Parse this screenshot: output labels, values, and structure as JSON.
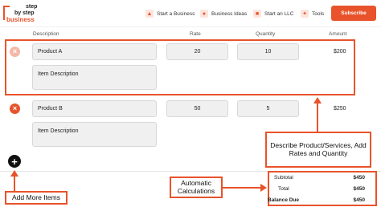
{
  "nav": {
    "logo": {
      "line1": "step",
      "line2": "by step",
      "line3": "business"
    },
    "links": [
      {
        "label": "Start a Business",
        "icon": "rocket-icon"
      },
      {
        "label": "Business Ideas",
        "icon": "lightbulb-icon"
      },
      {
        "label": "Start an LLC",
        "icon": "building-icon"
      },
      {
        "label": "Tools",
        "icon": "tools-icon"
      }
    ],
    "subscribe_label": "Subscribe"
  },
  "columns": {
    "description": "Description",
    "rate": "Rate",
    "quantity": "Quantity",
    "amount": "Amount"
  },
  "items": [
    {
      "product": "Product A",
      "item_description": "Item Description",
      "rate": "20",
      "quantity": "10",
      "amount": "$200"
    },
    {
      "product": "Product B",
      "item_description": "Item Description",
      "rate": "50",
      "quantity": "5",
      "amount": "$250"
    }
  ],
  "totals": {
    "subtotal_label": "Subtotal",
    "subtotal_value": "$450",
    "total_label": "Total",
    "total_value": "$450",
    "balance_label": "Balance Due",
    "balance_value": "$450"
  },
  "annotations": {
    "describe": "Describe Product/Services, Add Rates and Quantity",
    "automatic": "Automatic Calculations",
    "add_more": "Add More Items"
  },
  "colors": {
    "accent": "#e8532b",
    "field_bg": "#f0f0f0"
  }
}
